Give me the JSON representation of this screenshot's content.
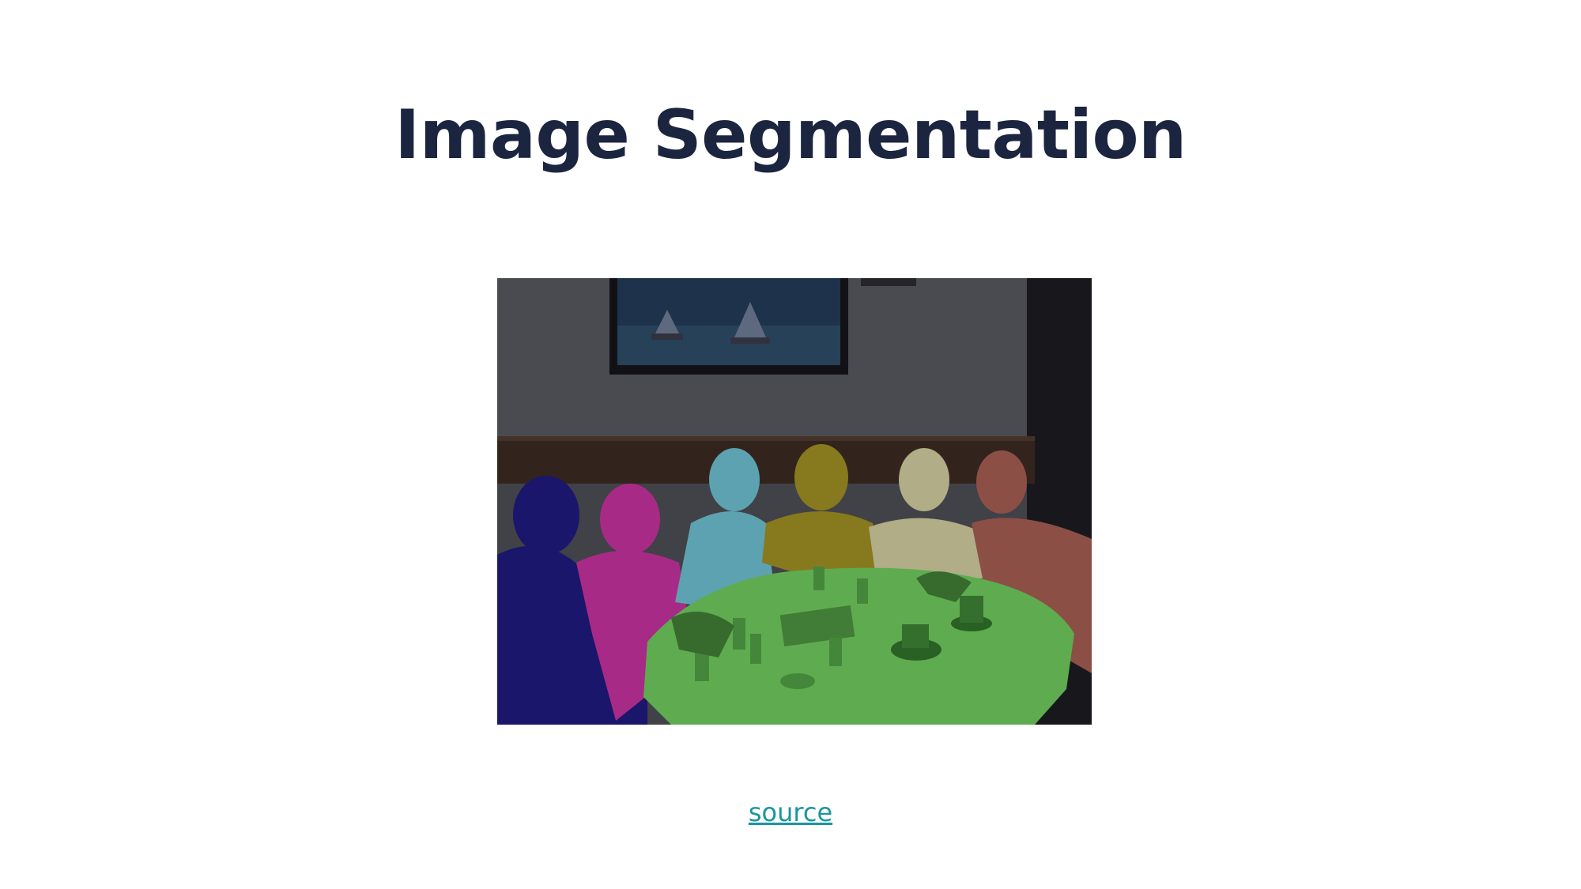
{
  "slide": {
    "title": "Image Segmentation",
    "source_link": "source"
  },
  "image": {
    "segment_colors": {
      "person_1": "#1e1a7a",
      "person_2": "#c0309a",
      "person_3": "#6ab9c9",
      "person_4": "#9a8a22",
      "person_5": "#c9c59a",
      "person_6": "#a05a50",
      "table": "#6bc45a"
    }
  }
}
